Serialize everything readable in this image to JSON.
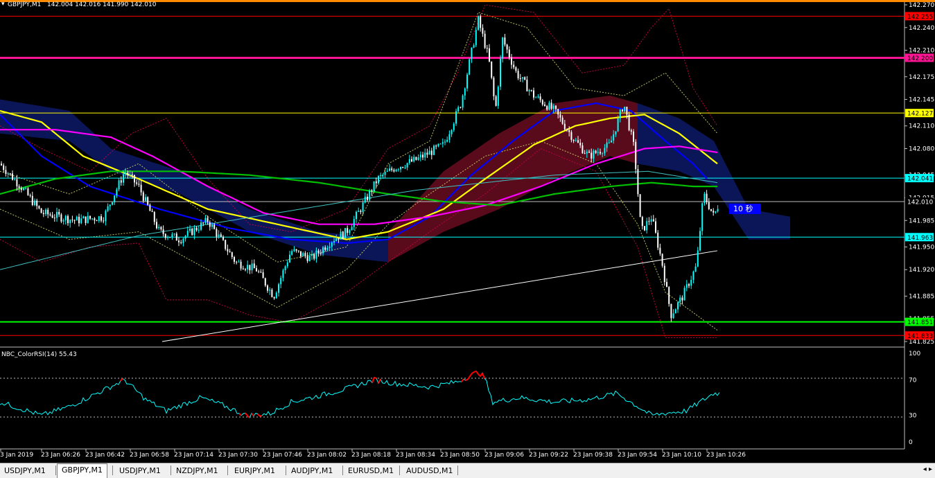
{
  "chart_header": {
    "symbol": "GBPJPY,M1",
    "ohlc": "142.004 142.016 141.990 142.010"
  },
  "countdown_label": "10 秒",
  "price_axis": {
    "ticks": [
      "142.270",
      "142.240",
      "142.210",
      "142.175",
      "142.145",
      "142.110",
      "142.080",
      "142.045",
      "142.015",
      "141.985",
      "141.950",
      "141.920",
      "141.885",
      "141.855",
      "141.825"
    ]
  },
  "price_labels": [
    {
      "value": "142.255",
      "bg": "#ff0000",
      "fg": "#000000"
    },
    {
      "value": "142.200",
      "bg": "#ff1493",
      "fg": "#000000"
    },
    {
      "value": "142.127",
      "bg": "#ffff00",
      "fg": "#000000"
    },
    {
      "value": "142.041",
      "bg": "#00ffff",
      "fg": "#000000"
    },
    {
      "value": "142.010",
      "bg": "#000000",
      "fg": "#ffffff"
    },
    {
      "value": "141.963",
      "bg": "#00ffff",
      "fg": "#000000"
    },
    {
      "value": "141.851",
      "bg": "#00ff00",
      "fg": "#000000"
    },
    {
      "value": "141.833",
      "bg": "#ff0000",
      "fg": "#000000"
    }
  ],
  "rsi": {
    "title": "NBC_ColorRSI(14) 55.43",
    "levels": [
      "100",
      "70",
      "30",
      "0"
    ]
  },
  "time_axis": [
    "3 Jan 2019",
    "23 Jan 06:26",
    "23 Jan 06:42",
    "23 Jan 06:58",
    "23 Jan 07:14",
    "23 Jan 07:30",
    "23 Jan 07:46",
    "23 Jan 08:02",
    "23 Jan 08:18",
    "23 Jan 08:34",
    "23 Jan 08:50",
    "23 Jan 09:06",
    "23 Jan 09:22",
    "23 Jan 09:38",
    "23 Jan 09:54",
    "23 Jan 10:10",
    "23 Jan 10:26"
  ],
  "tabs": [
    {
      "label": "USDJPY,M1",
      "active": false
    },
    {
      "label": "GBPJPY,M1",
      "active": true
    },
    {
      "label": "USDJPY,M1",
      "active": false
    },
    {
      "label": "NZDJPY,M1",
      "active": false
    },
    {
      "label": "EURJPY,M1",
      "active": false
    },
    {
      "label": "AUDJPY,M1",
      "active": false
    },
    {
      "label": "EURUSD,M1",
      "active": false
    },
    {
      "label": "AUDUSD,M1",
      "active": false
    }
  ],
  "colors": {
    "candle": "#00ffff",
    "candle_down": "#ffffff",
    "ma_blue": "#0000ff",
    "ma_yellow": "#ffff00",
    "ma_magenta": "#ff00ff",
    "ma_green": "#00c000",
    "rsi_line": "#00ffff",
    "rsi_hot": "#ff0000"
  }
}
